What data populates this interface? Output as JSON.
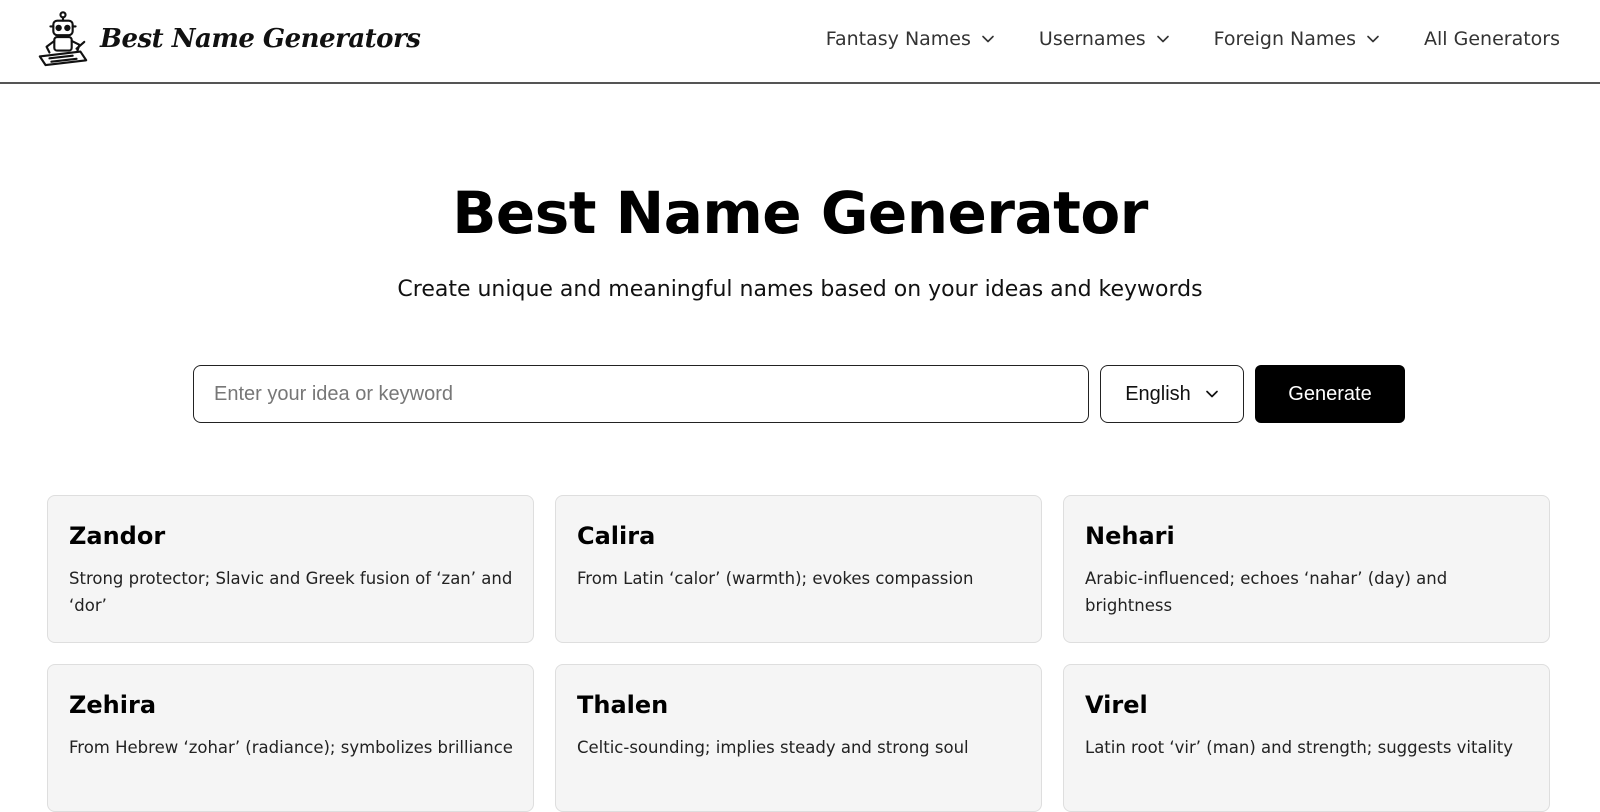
{
  "brand": {
    "name": "Best Name Generators"
  },
  "nav": {
    "items": [
      {
        "label": "Fantasy Names",
        "has_dropdown": true
      },
      {
        "label": "Usernames",
        "has_dropdown": true
      },
      {
        "label": "Foreign Names",
        "has_dropdown": true
      },
      {
        "label": "All Generators",
        "has_dropdown": false
      }
    ]
  },
  "hero": {
    "title": "Best Name Generator",
    "subtitle": "Create unique and meaningful names based on your ideas and keywords"
  },
  "search": {
    "placeholder": "Enter your idea or keyword",
    "value": "",
    "language": "English",
    "generate_label": "Generate"
  },
  "results": [
    {
      "name": "Zandor",
      "description": "Strong protector; Slavic and Greek fusion of ‘zan’ and ‘dor’"
    },
    {
      "name": "Calira",
      "description": "From Latin ‘calor’ (warmth); evokes compassion"
    },
    {
      "name": "Nehari",
      "description": "Arabic-influenced; echoes ‘nahar’ (day) and brightness"
    },
    {
      "name": "Zehira",
      "description": "From Hebrew ‘zohar’ (radiance); symbolizes brilliance"
    },
    {
      "name": "Thalen",
      "description": "Celtic-sounding; implies steady and strong soul"
    },
    {
      "name": "Virel",
      "description": "Latin root ‘vir’ (man) and strength; suggests vitality"
    }
  ],
  "colors": {
    "primary_button": "#000000",
    "card_background": "#f5f5f5",
    "header_border": "#555555"
  }
}
